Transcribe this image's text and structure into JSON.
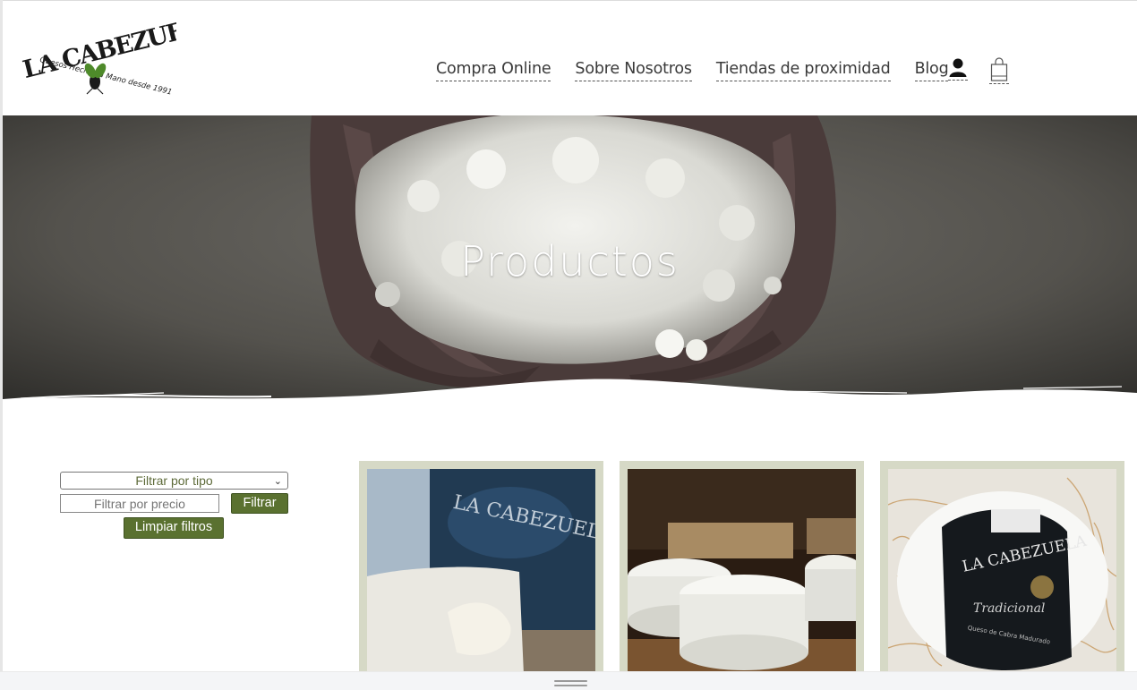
{
  "brand": {
    "name": "LA CABEZUELA",
    "tagline": "Quesos Hechos a Mano desde 1991"
  },
  "nav": {
    "items": [
      {
        "label": "Compra Online"
      },
      {
        "label": "Sobre Nosotros"
      },
      {
        "label": "Tiendas de proximidad"
      },
      {
        "label": "Blog"
      }
    ],
    "user_icon": "user-icon",
    "cart_icon": "shopping-bag-icon"
  },
  "hero": {
    "title": "Productos"
  },
  "filters": {
    "type_select_value": "Filtrar por tipo",
    "price_placeholder": "Filtrar por precio",
    "filter_button": "Filtrar",
    "clear_button": "Limpiar filtros"
  },
  "products": [
    {
      "image": "soft-cheese-with-labeled-package"
    },
    {
      "image": "fresh-cheese-wheels-on-shelf"
    },
    {
      "image": "labeled-cheese-wheel-in-straw"
    }
  ],
  "colors": {
    "button_green": "#5a7130",
    "card_background": "#d6d9c6",
    "nav_text": "#3a3a3a",
    "hero_title": "#ffffff"
  }
}
